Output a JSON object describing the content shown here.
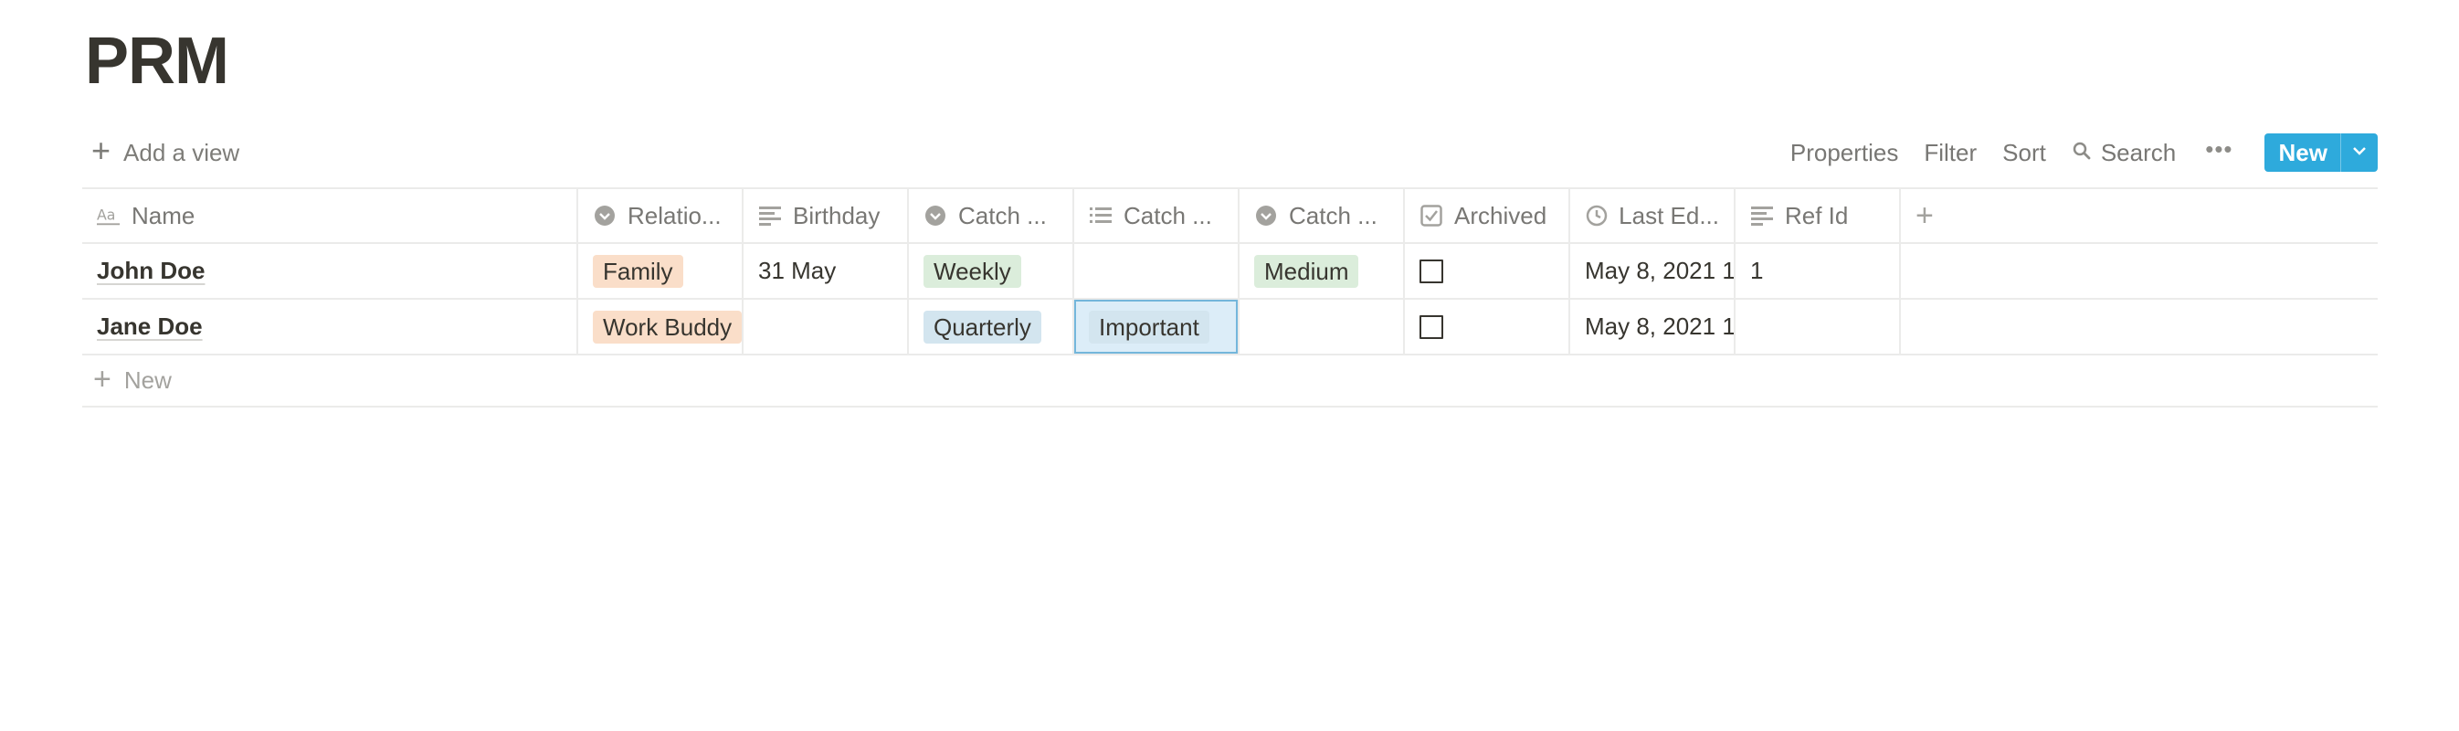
{
  "page": {
    "title": "PRM"
  },
  "toolbar": {
    "add_view_label": "Add a view",
    "properties_label": "Properties",
    "filter_label": "Filter",
    "sort_label": "Sort",
    "search_label": "Search",
    "more_label": "•••",
    "new_label": "New",
    "accent_color": "#2eaadc"
  },
  "table": {
    "columns": [
      {
        "label": "Name",
        "icon": "text-aa-icon"
      },
      {
        "label": "Relatio...",
        "icon": "select-icon"
      },
      {
        "label": "Birthday",
        "icon": "text-lines-icon"
      },
      {
        "label": "Catch ...",
        "icon": "select-icon"
      },
      {
        "label": "Catch ...",
        "icon": "list-icon"
      },
      {
        "label": "Catch ...",
        "icon": "select-icon"
      },
      {
        "label": "Archived",
        "icon": "checkbox-icon"
      },
      {
        "label": "Last Ed...",
        "icon": "clock-icon"
      },
      {
        "label": "Ref Id",
        "icon": "text-lines-icon"
      }
    ],
    "add_column_label": "+",
    "rows": [
      {
        "name": "John Doe",
        "relationship": "Family",
        "birthday": "31 May",
        "catch_freq": "Weekly",
        "catch_tags": "",
        "catch_level": "Medium",
        "archived": false,
        "last_edited": "May 8, 2021 1",
        "ref_id": "1"
      },
      {
        "name": "Jane Doe",
        "relationship": "Work Buddy",
        "birthday": "",
        "catch_freq": "Quarterly",
        "catch_tags": "Important",
        "catch_level": "",
        "archived": false,
        "last_edited": "May 8, 2021 1",
        "ref_id": ""
      }
    ],
    "add_row_label": "New"
  },
  "colors": {
    "tag_orange": "#fadec9",
    "tag_green": "#dbeddb",
    "tag_blue": "#d3e5ef",
    "selection": "#74b6db"
  }
}
